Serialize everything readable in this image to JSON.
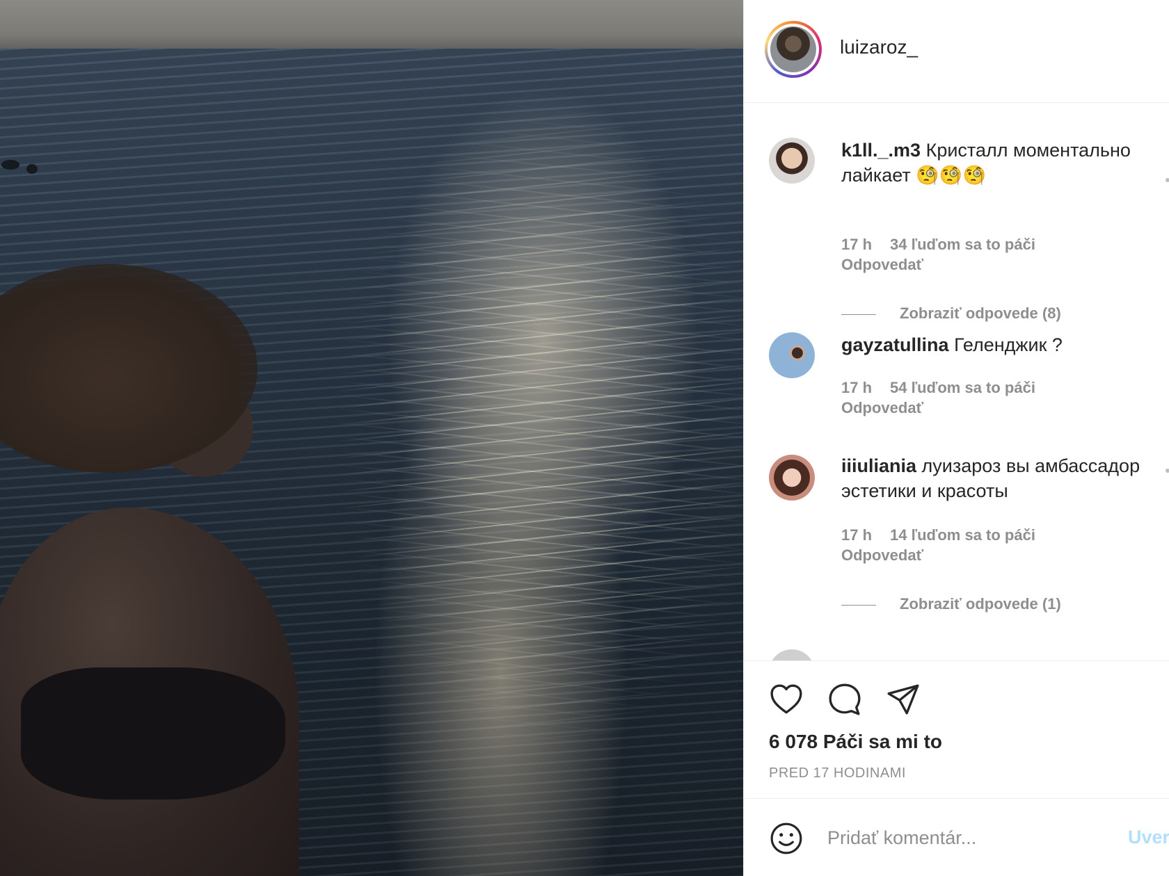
{
  "post": {
    "username": "luizaroz_",
    "likes_label": "6 078 Páči sa mi to",
    "timestamp": "PRED 17 HODINAMI"
  },
  "comments": [
    {
      "user": "k1ll._.m3",
      "text": "Кристалл моментально лайкает 🧐🧐🧐",
      "time": "17 h",
      "likes": "34 ľuďom sa to páči",
      "reply": "Odpovedať",
      "view_replies": "Zobraziť odpovede (8)"
    },
    {
      "user": "gayzatullina",
      "text": "Геленджик ?",
      "time": "17 h",
      "likes": "54 ľuďom sa to páči",
      "reply": "Odpovedať"
    },
    {
      "user": "iiiuliania",
      "text": "луизароз вы амбассадор эстетики и красоты",
      "time": "17 h",
      "likes": "14 ľuďom sa to páči",
      "reply": "Odpovedať",
      "view_replies": "Zobraziť odpovede (1)"
    }
  ],
  "comment_box": {
    "placeholder": "Pridať komentár...",
    "post_label": "Uver"
  },
  "icons": {
    "like": "heart-icon",
    "comment": "comment-bubble-icon",
    "share": "paper-plane-icon",
    "emoji": "smiley-icon"
  },
  "colors": {
    "text": "#262626",
    "muted": "#8e8e8e",
    "post_button": "#b2dffc"
  }
}
